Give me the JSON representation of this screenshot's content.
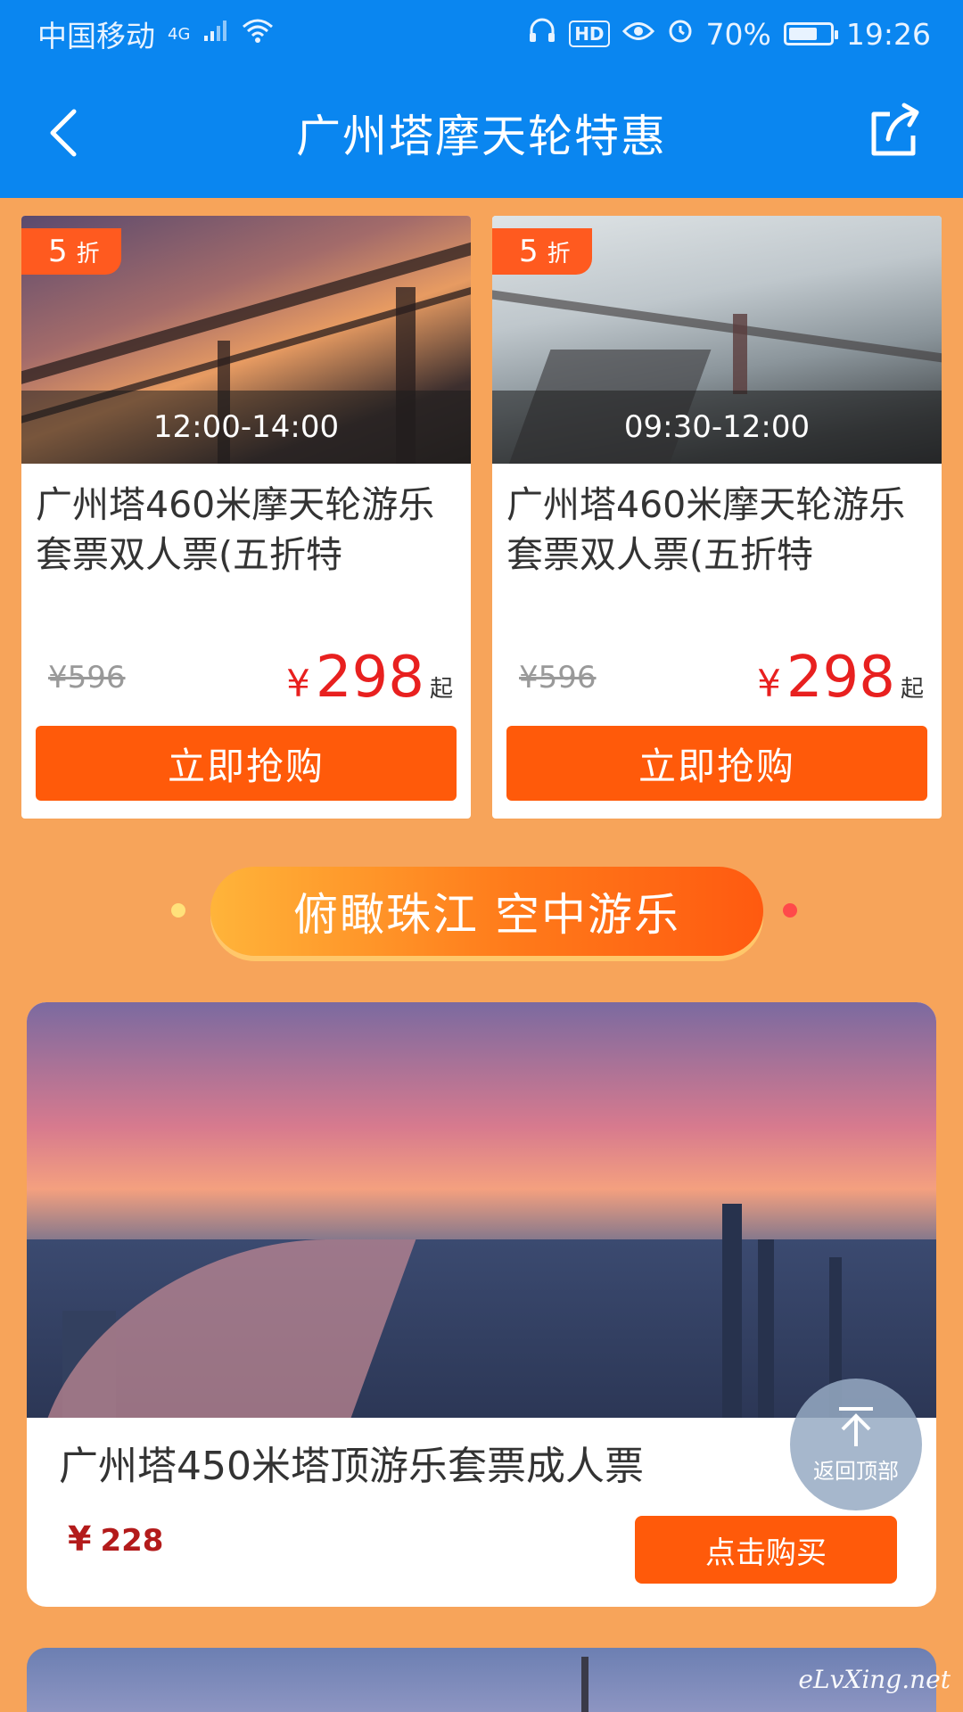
{
  "status_bar": {
    "carrier": "中国移动",
    "network": "4G",
    "battery_text": "70%",
    "battery_level": 0.7,
    "time": "19:26",
    "hd_label": "HD"
  },
  "nav": {
    "title": "广州塔摩天轮特惠"
  },
  "cards": [
    {
      "discount_num": "5",
      "discount_unit": "折",
      "time_slot": "12:00-14:00",
      "title": "广州塔460米摩天轮游乐套票双人票(五折特",
      "old_price": "¥596",
      "price_symbol": "¥",
      "price": "298",
      "price_suffix": "起",
      "button": "立即抢购"
    },
    {
      "discount_num": "5",
      "discount_unit": "折",
      "time_slot": "09:30-12:00",
      "title": "广州塔460米摩天轮游乐套票双人票(五折特",
      "old_price": "¥596",
      "price_symbol": "¥",
      "price": "298",
      "price_suffix": "起",
      "button": "立即抢购"
    }
  ],
  "section": {
    "title": "俯瞰珠江 空中游乐"
  },
  "featured": {
    "title": "广州塔450米塔顶游乐套票成人票",
    "price_symbol": "¥",
    "price": "228",
    "button": "点击购买"
  },
  "back_to_top": {
    "label": "返回顶部"
  },
  "watermark": "eLvXing.net",
  "colors": {
    "brand_blue": "#0a86f0",
    "background_orange": "#f7a45a",
    "button_orange": "#ff5a0a",
    "price_red": "#e8201f"
  }
}
